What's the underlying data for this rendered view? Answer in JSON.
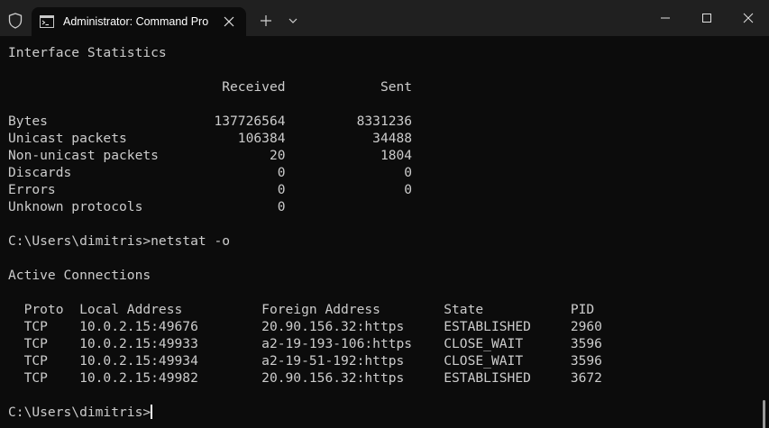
{
  "window": {
    "tab_title": "Administrator: Command Pro",
    "icons": {
      "shield": "shield-icon",
      "tab": "cmd-prompt-icon",
      "tab_close": "close-icon",
      "new_tab": "plus-icon",
      "dropdown": "chevron-down-icon",
      "minimize": "minimize-icon",
      "maximize": "maximize-icon",
      "close": "close-icon"
    }
  },
  "colors": {
    "background": "#0c0c0c",
    "titlebar": "#202020",
    "text": "#cccccc"
  },
  "terminal": {
    "lines": [
      "Interface Statistics",
      "",
      "                           Received            Sent",
      "",
      "Bytes                     137726564         8331236",
      "Unicast packets              106384           34488",
      "Non-unicast packets              20            1804",
      "Discards                          0               0",
      "Errors                            0               0",
      "Unknown protocols                 0",
      "",
      "C:\\Users\\dimitris>netstat -o",
      "",
      "Active Connections",
      "",
      "  Proto  Local Address          Foreign Address        State           PID",
      "  TCP    10.0.2.15:49676        20.90.156.32:https     ESTABLISHED     2960",
      "  TCP    10.0.2.15:49933        a2-19-193-106:https    CLOSE_WAIT      3596",
      "  TCP    10.0.2.15:49934        a2-19-51-192:https     CLOSE_WAIT      3596",
      "  TCP    10.0.2.15:49982        20.90.156.32:https     ESTABLISHED     3672",
      ""
    ],
    "prompt": "C:\\Users\\dimitris>"
  }
}
